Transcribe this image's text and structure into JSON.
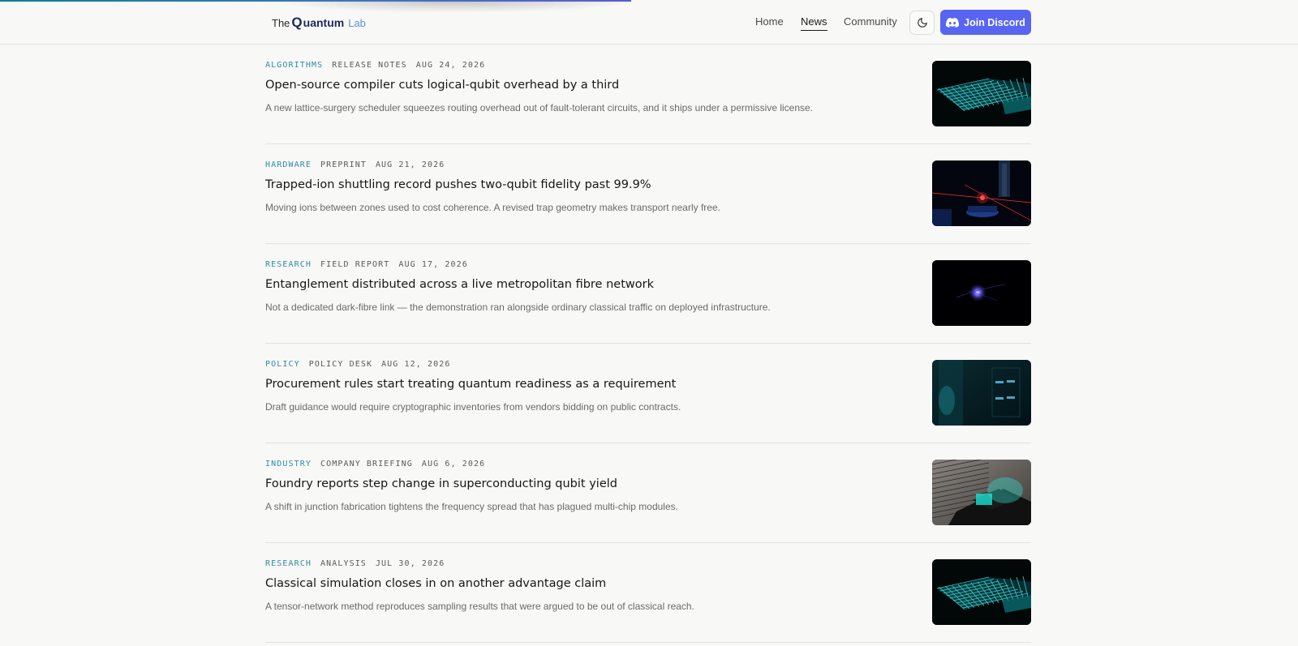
{
  "header": {
    "logo": {
      "the": "The",
      "q": "Q",
      "uantum": "uantum",
      "lab": "Lab"
    },
    "nav": [
      {
        "label": "Home",
        "active": false
      },
      {
        "label": "News",
        "active": true
      },
      {
        "label": "Community",
        "active": false
      }
    ],
    "theme_toggle_icon": "moon-icon",
    "discord_button": {
      "label": "Join Discord",
      "icon": "discord-icon",
      "color": "#5865f2"
    }
  },
  "colors": {
    "accent": "#2b8ea3",
    "brand": "#1a2b5a",
    "discord": "#5865f2"
  },
  "articles": [
    {
      "category": "ALGORITHMS",
      "kind": "RELEASE NOTES",
      "date": "AUG 24, 2026",
      "title": "Open-source compiler cuts logical-qubit overhead by a third",
      "summary": "A new lattice-surgery scheduler squeezes routing overhead out of fault-tolerant circuits, and it ships under a permissive license.",
      "thumb": "lattice"
    },
    {
      "category": "HARDWARE",
      "kind": "PREPRINT",
      "date": "AUG 21, 2026",
      "title": "Trapped-ion shuttling record pushes two-qubit fidelity past 99.9%",
      "summary": "Moving ions between zones used to cost coherence. A revised trap geometry makes transport nearly free.",
      "thumb": "lasers"
    },
    {
      "category": "RESEARCH",
      "kind": "FIELD REPORT",
      "date": "AUG 17, 2026",
      "title": "Entanglement distributed across a live metropolitan fibre network",
      "summary": "Not a dedicated dark-fibre link — the demonstration ran alongside ordinary classical traffic on deployed infrastructure.",
      "thumb": "spark"
    },
    {
      "category": "POLICY",
      "kind": "POLICY DESK",
      "date": "AUG 12, 2026",
      "title": "Procurement rules start treating quantum readiness as a requirement",
      "summary": "Draft guidance would require cryptographic inventories from vendors bidding on public contracts.",
      "thumb": "servers"
    },
    {
      "category": "INDUSTRY",
      "kind": "COMPANY BRIEFING",
      "date": "AUG 6, 2026",
      "title": "Foundry reports step change in superconducting qubit yield",
      "summary": "A shift in junction fabrication tightens the frequency spread that has plagued multi-chip modules.",
      "thumb": "chip"
    },
    {
      "category": "RESEARCH",
      "kind": "ANALYSIS",
      "date": "JUL 30, 2026",
      "title": "Classical simulation closes in on another advantage claim",
      "summary": "A tensor-network method reproduces sampling results that were argued to be out of classical reach.",
      "thumb": "lattice"
    }
  ]
}
